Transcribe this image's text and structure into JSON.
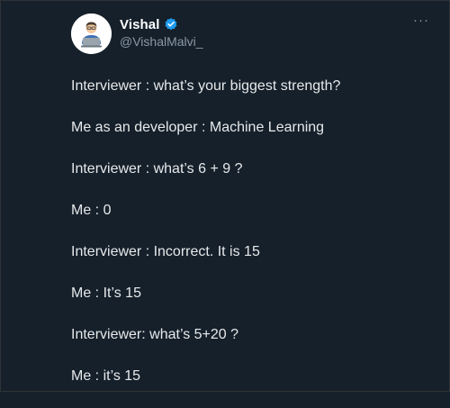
{
  "author": {
    "name": "Vishal",
    "handle": "@VishalMalvi_"
  },
  "icons": {
    "avatar": "developer-avatar",
    "verified": "verified-badge-icon",
    "more": "more-options-icon"
  },
  "colors": {
    "background": "#15202b",
    "text": "#e7e9ea",
    "secondary_text": "#8b98a5",
    "verified_blue": "#1d9bf0"
  },
  "more_label": "···",
  "tweet_lines": [
    "Interviewer : what’s your biggest strength?",
    "Me as an developer : Machine Learning",
    "Interviewer : what’s 6 + 9 ?",
    "Me : 0",
    "Interviewer : Incorrect. It is 15",
    "Me : It’s 15",
    "Interviewer: what’s 5+20 ?",
    "Me : it’s 15"
  ]
}
